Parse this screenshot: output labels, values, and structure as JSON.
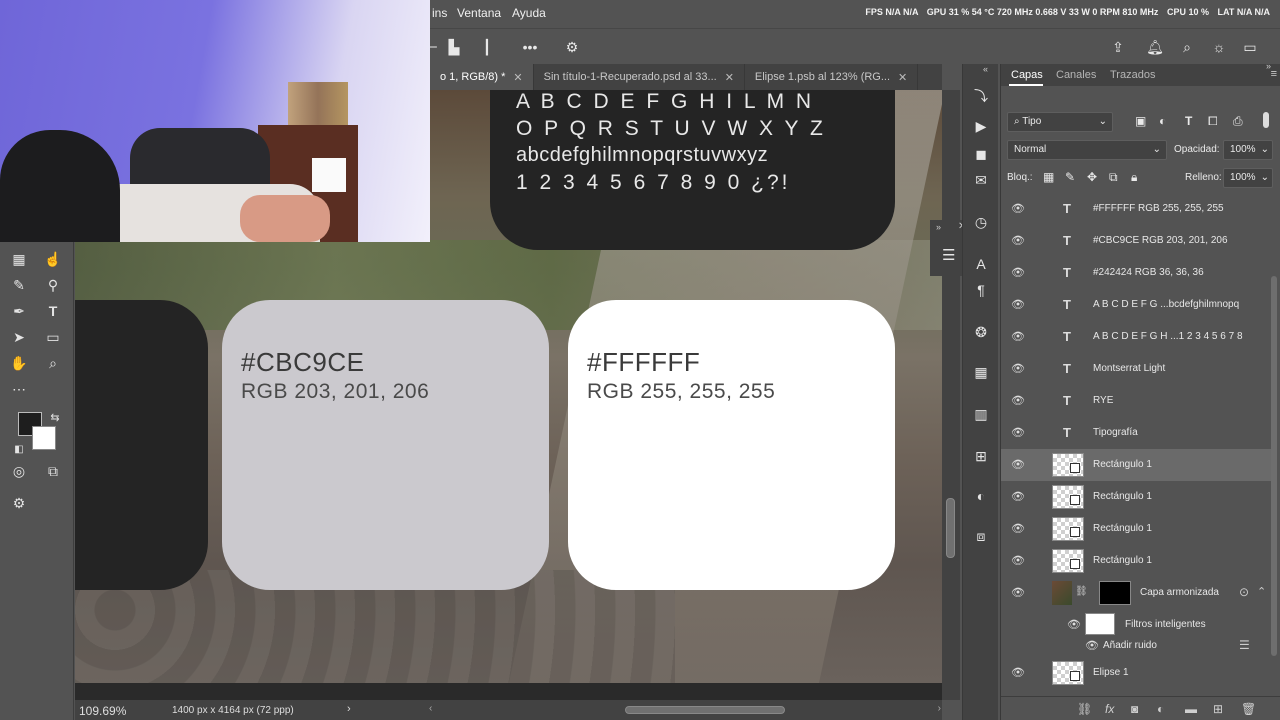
{
  "menu": {
    "items": [
      "ins",
      "Ventana",
      "Ayuda"
    ]
  },
  "perf": {
    "fps": "FPS  N/A  N/A",
    "gpu": "GPU 31 % 54 °C 720 MHz 0.668 V 33 W 0 RPM 810 MHz",
    "cpu": "CPU 10 %",
    "lat": "LAT N/A N/A"
  },
  "tabs": [
    {
      "label": "o 1, RGB/8) *",
      "active": true
    },
    {
      "label": "Sin título-1-Recuperado.psd al 33...",
      "active": false
    },
    {
      "label": "Elipse 1.psb al 123% (RG...",
      "active": false
    }
  ],
  "canvas": {
    "typography": {
      "line1": "A B C D E F G H I L M N",
      "line2": "O P Q R S T U V W X Y Z",
      "line3": "abcdefghilmnopqrstuvwxyz",
      "line4": "1 2 3 4 5 6 7 8 9 0 ¿?!"
    },
    "swatches": [
      {
        "hex": "#CBC9CE",
        "rgb": "RGB 203, 201, 206",
        "color": "#cbc9ce"
      },
      {
        "hex": "#FFFFFF",
        "rgb": "RGB 255, 255, 255",
        "color": "#ffffff"
      }
    ],
    "dark_color": "#242424"
  },
  "status": {
    "zoom": "109.69%",
    "dims": "1400 px x 4164 px (72 ppp)"
  },
  "layers_panel": {
    "tabs": [
      "Capas",
      "Canales",
      "Trazados"
    ],
    "filter_type": "Tipo",
    "blend_mode": "Normal",
    "opacity_label": "Opacidad:",
    "opacity_value": "100%",
    "lock_label": "Bloq.:",
    "fill_label": "Relleno:",
    "fill_value": "100%",
    "layers": [
      {
        "name": "#FFFFFF RGB 255, 255, 255",
        "kind": "text"
      },
      {
        "name": "#CBC9CE RGB 203, 201, 206",
        "kind": "text"
      },
      {
        "name": "#242424 RGB 36, 36, 36",
        "kind": "text"
      },
      {
        "name": "A B C D E F G ...bcdefghilmnopq",
        "kind": "text"
      },
      {
        "name": "A B C D E F G H ...1 2 3 4 5 6 7 8",
        "kind": "text"
      },
      {
        "name": "Montserrat Light",
        "kind": "text"
      },
      {
        "name": "RYE",
        "kind": "text"
      },
      {
        "name": "Tipografía",
        "kind": "text"
      },
      {
        "name": "Rectángulo 1",
        "kind": "shape",
        "selected": true
      },
      {
        "name": "Rectángulo 1",
        "kind": "shape"
      },
      {
        "name": "Rectángulo 1",
        "kind": "shape"
      },
      {
        "name": "Rectángulo 1",
        "kind": "shape"
      },
      {
        "name": "Capa armonizada",
        "kind": "smart"
      },
      {
        "name": "Filtros inteligentes",
        "kind": "filter"
      },
      {
        "name": "Añadir ruido",
        "kind": "effect"
      },
      {
        "name": "Elipse 1",
        "kind": "shape"
      }
    ]
  },
  "colors": {
    "fg": "#1e1e1e",
    "bg": "#ffffff"
  }
}
